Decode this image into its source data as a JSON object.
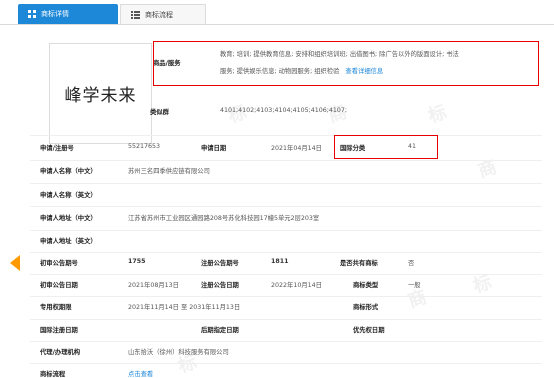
{
  "tabs": [
    {
      "label": "商标详情",
      "icon": "grid-icon",
      "active": true
    },
    {
      "label": "商标流程",
      "icon": "list-icon",
      "active": false
    }
  ],
  "trademark_name": "峰学未来",
  "goods": {
    "label": "商品/服务",
    "line1": "教育; 培训; 提供教育信息; 安排和组织培训班; 出借图书; 除广告以外的版面设计; 书法",
    "line2": "服务; 提供娱乐信息; 动物园服务; 组织检验",
    "link": "查看详细信息"
  },
  "similar_group": {
    "label": "类似群",
    "value": "4101;4102;4103;4104;4105;4106;4107;"
  },
  "rows": {
    "reg_no_label": "申请/注册号",
    "reg_no": "55217653",
    "app_date_label": "申请日期",
    "app_date": "2021年04月14日",
    "intl_class_label": "国际分类",
    "intl_class": "41",
    "applicant_cn_label": "申请人名称（中文）",
    "applicant_cn": "苏州三名四季供应链有限公司",
    "applicant_en_label": "申请人名称（英文）",
    "address_cn_label": "申请人地址（中文）",
    "address_cn": "江苏省苏州市工业园区通园路208号苏化科技园17幢5单元2层203室",
    "address_en_label": "申请人地址（英文）",
    "prelim_no_label": "初审公告期号",
    "prelim_no": "1755",
    "reg_notice_no_label": "注册公告期号",
    "reg_notice_no": "1811",
    "shared_label": "是否共有商标",
    "shared": "否",
    "prelim_date_label": "初审公告日期",
    "prelim_date": "2021年08月13日",
    "reg_notice_date_label": "注册公告日期",
    "reg_notice_date": "2022年10月14日",
    "tm_type_label": "商标类型",
    "tm_type": "一般",
    "exclusive_label": "专用权期限",
    "exclusive": "2021年11月14日 至 2031年11月13日",
    "tm_form_label": "商标形式",
    "intl_reg_label": "国际注册日期",
    "later_reg_label": "后期指定日期",
    "priority_label": "优先权日期",
    "agent_label": "代理/办理机构",
    "agent": "山东拾沃（徐州）科技服务有限公司",
    "flow_label": "商标流程",
    "flow_link": "点击查看"
  },
  "colors": {
    "accent": "#1e88d8",
    "highlight": "#e60000",
    "arrow": "#ff9900"
  }
}
